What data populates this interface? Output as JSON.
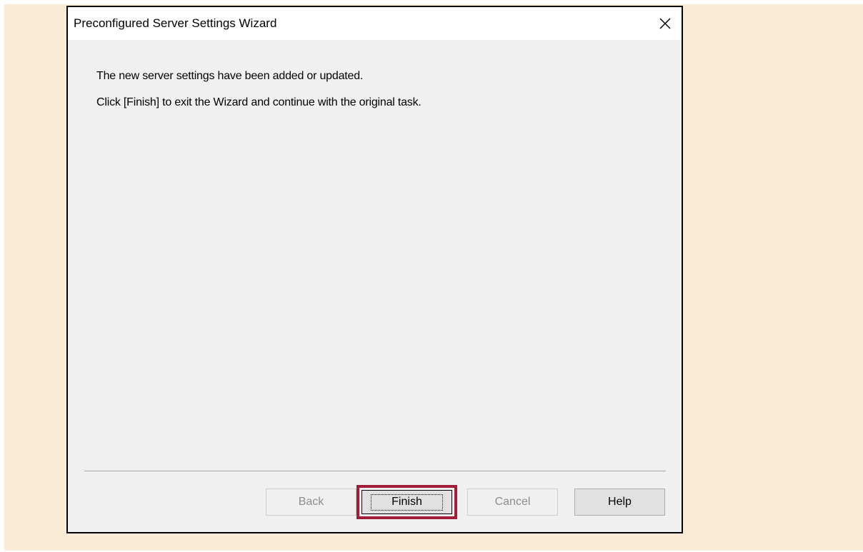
{
  "window": {
    "title": "Preconfigured Server Settings Wizard",
    "close_icon": "close-icon"
  },
  "message": {
    "line1": "The new server settings have been added or updated.",
    "line2": "Click [Finish] to exit the Wizard and continue with the original task."
  },
  "buttons": {
    "back": "Back",
    "finish": "Finish",
    "cancel": "Cancel",
    "help": "Help"
  },
  "colors": {
    "backdrop": "#faebd7",
    "dialog": "#f0f0f0",
    "highlight": "#a31d3a"
  }
}
